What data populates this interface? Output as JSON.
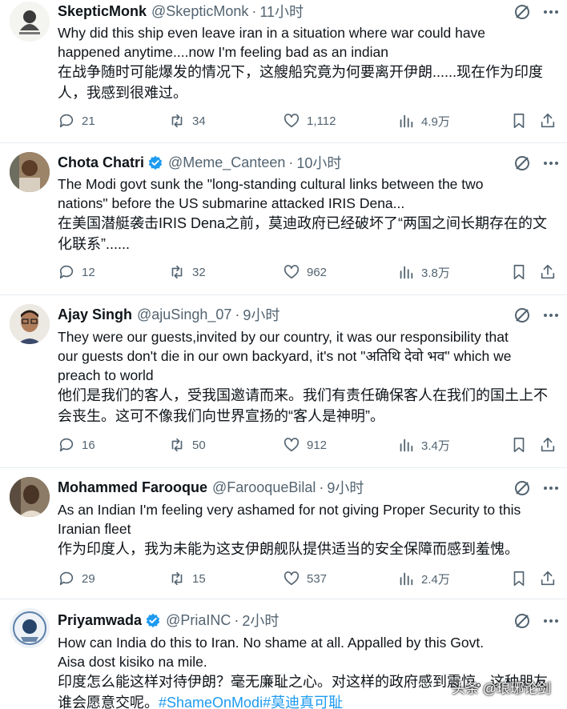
{
  "colors": {
    "text": "#0f1419",
    "muted": "#536471",
    "accent": "#1d9bf0",
    "divider": "#e6ecf0"
  },
  "tweets": [
    {
      "name": "SkepticMonk",
      "handle": "@SkepticMonk",
      "time": "11小时",
      "verified": false,
      "lines": [
        "Why did this ship even leave iran in a situation where war could have",
        "happened anytime....now I'm feeling bad as an indian"
      ],
      "translation": [
        "在战争随时可能爆发的情况下，这艘船究竟为何要离开伊朗......现在作为印度",
        "人，我感到很难过。"
      ],
      "replies": "21",
      "reposts": "34",
      "likes": "1,112",
      "views": "4.9万"
    },
    {
      "name": "Chota Chatri",
      "handle": "@Meme_Canteen",
      "time": "10小时",
      "verified": true,
      "lines": [
        "The Modi govt sunk the \"long-standing cultural links between the two",
        "nations\" before the US submarine attacked IRIS Dena..."
      ],
      "translation": [
        "在美国潜艇袭击IRIS Dena之前，莫迪政府已经破坏了“两国之间长期存在的文",
        "化联系”......"
      ],
      "replies": "12",
      "reposts": "32",
      "likes": "962",
      "views": "3.8万"
    },
    {
      "name": "Ajay Singh",
      "handle": "@ajuSingh_07",
      "time": "9小时",
      "verified": false,
      "lines": [
        "They were our guests,invited by our country, it was our responsibility that",
        "our guests don't die in our own backyard, it's not \"अतिथि देवो भव\" which we",
        "preach to world"
      ],
      "translation": [
        "他们是我们的客人，受我国邀请而来。我们有责任确保客人在我们的国土上不",
        "会丧生。这可不像我们向世界宣扬的“客人是神明”。"
      ],
      "replies": "16",
      "reposts": "50",
      "likes": "912",
      "views": "3.4万"
    },
    {
      "name": "Mohammed Farooque",
      "handle": "@FarooqueBilal",
      "time": "9小时",
      "verified": false,
      "lines": [
        "As an Indian I'm feeling very ashamed for not giving Proper Security to this",
        "Iranian fleet"
      ],
      "translation": [
        "作为印度人，我为未能为这支伊朗舰队提供适当的安全保障而感到羞愧。"
      ],
      "replies": "29",
      "reposts": "15",
      "likes": "537",
      "views": "2.4万"
    },
    {
      "name": "Priyamwada",
      "handle": "@PriaINC",
      "time": "2小时",
      "verified": true,
      "lines": [
        "How can India do this to Iran. No shame at all. Appalled by this Govt.",
        "Aisa dost kisiko na mile."
      ],
      "translation": [
        "印度怎么能这样对待伊朗？毫无廉耻之心。对这样的政府感到震惊。这种朋友",
        "谁会愿意交呢。"
      ],
      "hashtags": "#ShameOnModi#莫迪真可耻"
    }
  ],
  "watermark": "头条 @琅琊论剑"
}
